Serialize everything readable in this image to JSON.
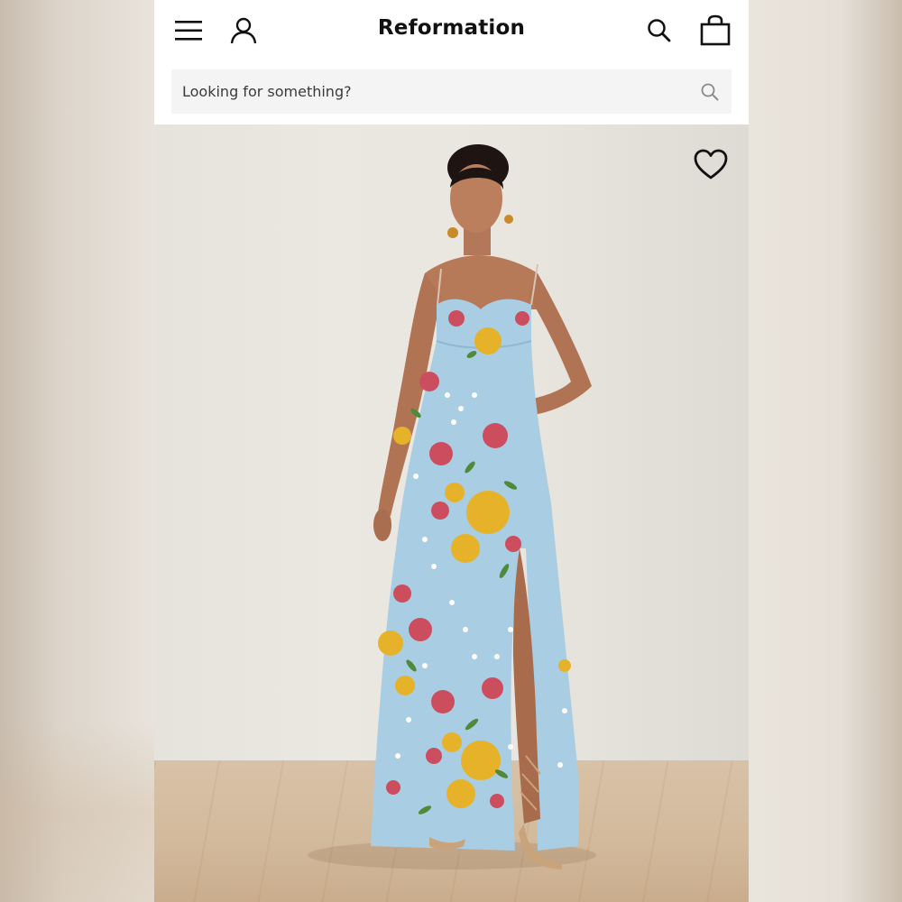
{
  "brand": {
    "name": "Reformation"
  },
  "header": {
    "menu_icon": "hamburger-menu-icon",
    "account_icon": "user-icon",
    "search_icon": "search-icon",
    "bag_icon": "shopping-bag-icon"
  },
  "search": {
    "placeholder": "Looking for something?",
    "value": ""
  },
  "product": {
    "wishlist_icon": "heart-outline-icon"
  },
  "colors": {
    "dress_base": "#a9cde3",
    "flower_yellow": "#e6b22a",
    "flower_pink": "#cc4d5e",
    "leaf_green": "#4f8a3a",
    "skin": "#b77a58"
  }
}
